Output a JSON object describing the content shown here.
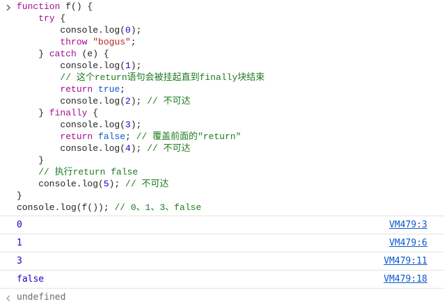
{
  "input": {
    "lines": [
      [
        {
          "t": "function",
          "c": "kw"
        },
        {
          "t": " f() {",
          "c": ""
        }
      ],
      [
        {
          "t": "    ",
          "c": ""
        },
        {
          "t": "try",
          "c": "kw"
        },
        {
          "t": " {",
          "c": ""
        }
      ],
      [
        {
          "t": "        console.log(",
          "c": ""
        },
        {
          "t": "0",
          "c": "num"
        },
        {
          "t": ");",
          "c": ""
        }
      ],
      [
        {
          "t": "        ",
          "c": ""
        },
        {
          "t": "throw",
          "c": "kw"
        },
        {
          "t": " ",
          "c": ""
        },
        {
          "t": "\"bogus\"",
          "c": "str"
        },
        {
          "t": ";",
          "c": ""
        }
      ],
      [
        {
          "t": "    } ",
          "c": ""
        },
        {
          "t": "catch",
          "c": "kw"
        },
        {
          "t": " (e) {",
          "c": ""
        }
      ],
      [
        {
          "t": "        console.log(",
          "c": ""
        },
        {
          "t": "1",
          "c": "num"
        },
        {
          "t": ");",
          "c": ""
        }
      ],
      [
        {
          "t": "        ",
          "c": ""
        },
        {
          "t": "// 这个return语句会被挂起直到finally块结束",
          "c": "cm"
        }
      ],
      [
        {
          "t": "        ",
          "c": ""
        },
        {
          "t": "return",
          "c": "kw"
        },
        {
          "t": " ",
          "c": ""
        },
        {
          "t": "true",
          "c": "lit"
        },
        {
          "t": ";",
          "c": ""
        }
      ],
      [
        {
          "t": "        console.log(",
          "c": ""
        },
        {
          "t": "2",
          "c": "num"
        },
        {
          "t": "); ",
          "c": ""
        },
        {
          "t": "// 不可达",
          "c": "cm"
        }
      ],
      [
        {
          "t": "    } ",
          "c": ""
        },
        {
          "t": "finally",
          "c": "kw"
        },
        {
          "t": " {",
          "c": ""
        }
      ],
      [
        {
          "t": "        console.log(",
          "c": ""
        },
        {
          "t": "3",
          "c": "num"
        },
        {
          "t": ");",
          "c": ""
        }
      ],
      [
        {
          "t": "        ",
          "c": ""
        },
        {
          "t": "return",
          "c": "kw"
        },
        {
          "t": " ",
          "c": ""
        },
        {
          "t": "false",
          "c": "lit"
        },
        {
          "t": "; ",
          "c": ""
        },
        {
          "t": "// 覆盖前面的\"return\"",
          "c": "cm"
        }
      ],
      [
        {
          "t": "        console.log(",
          "c": ""
        },
        {
          "t": "4",
          "c": "num"
        },
        {
          "t": "); ",
          "c": ""
        },
        {
          "t": "// 不可达",
          "c": "cm"
        }
      ],
      [
        {
          "t": "    }",
          "c": ""
        }
      ],
      [
        {
          "t": "    ",
          "c": ""
        },
        {
          "t": "// 执行return false",
          "c": "cm"
        }
      ],
      [
        {
          "t": "    console.log(",
          "c": ""
        },
        {
          "t": "5",
          "c": "num"
        },
        {
          "t": "); ",
          "c": ""
        },
        {
          "t": "// 不可达",
          "c": "cm"
        }
      ],
      [
        {
          "t": "}",
          "c": ""
        }
      ],
      [
        {
          "t": "console.log(f()); ",
          "c": ""
        },
        {
          "t": "// 0、1、3、false",
          "c": "cm"
        }
      ]
    ]
  },
  "outputs": [
    {
      "value": "0",
      "source": "VM479:3"
    },
    {
      "value": "1",
      "source": "VM479:6"
    },
    {
      "value": "3",
      "source": "VM479:11"
    },
    {
      "value": "false",
      "source": "VM479:18"
    }
  ],
  "result": {
    "value": "undefined"
  },
  "icons": {
    "prompt": "chevron-right-icon",
    "result": "chevron-left-icon"
  },
  "colors": {
    "keyword": "#a60b8f",
    "string": "#b3261e",
    "number": "#1c00cf",
    "literal": "#0b57d0",
    "comment": "#1e7a1e",
    "link": "#0b57d0"
  }
}
